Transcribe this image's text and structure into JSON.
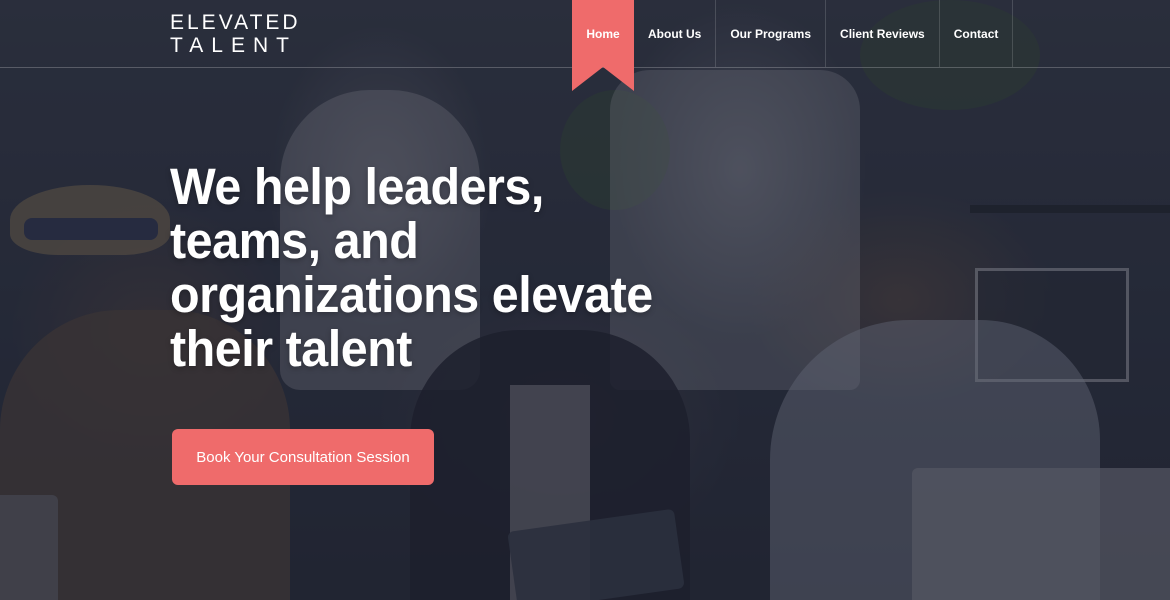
{
  "brand": {
    "logo_line1": "ELEVATED",
    "logo_line2": "TALENT",
    "accent_color": "#ef6b6b"
  },
  "nav": {
    "items": [
      {
        "label": "Home",
        "active": true
      },
      {
        "label": "About Us",
        "active": false
      },
      {
        "label": "Our Programs",
        "active": false
      },
      {
        "label": "Client Reviews",
        "active": false
      },
      {
        "label": "Contact",
        "active": false
      }
    ]
  },
  "hero": {
    "headline": "We help leaders, teams, and organizations elevate their talent",
    "cta_label": "Book Your Consultation Session"
  }
}
